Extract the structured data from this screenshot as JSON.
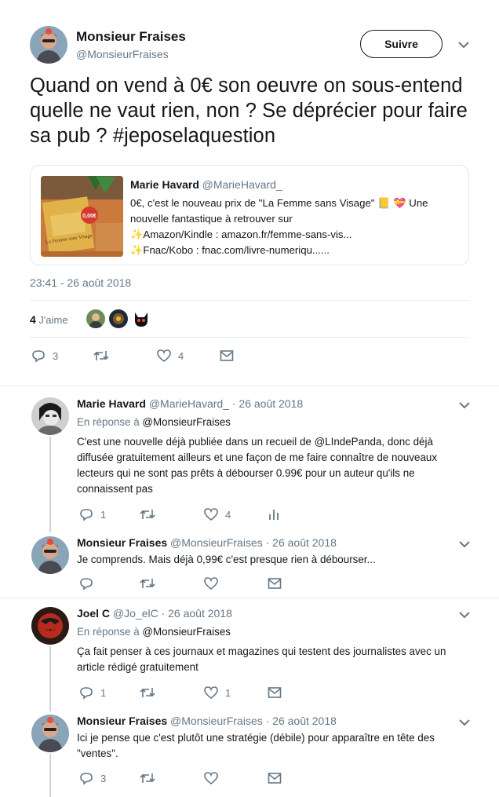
{
  "tweet": {
    "author_name": "Monsieur Fraises",
    "author_handle": "@MonsieurFraises",
    "follow_label": "Suivre",
    "text": "Quand on vend à 0€ son oeuvre on sous-entend quelle ne vaut rien, non ? Se déprécier pour faire sa pub ? #jeposelaquestion",
    "timestamp": "23:41 - 26 août 2018",
    "likes_count": "4",
    "likes_label": "J'aime",
    "replies": "3",
    "favorites": "4"
  },
  "quoted": {
    "author_name": "Marie Havard",
    "author_handle": "@MarieHavard_",
    "line1": "0€, c'est le nouveau prix de \"La Femme sans Visage\" 📒 💝 Une",
    "line2": "nouvelle fantastique à retrouver sur",
    "line3": "✨Amazon/Kindle : amazon.fr/femme-sans-vis...",
    "line4": "✨Fnac/Kobo : fnac.com/livre-numeriqu......",
    "image_price": "0,00€",
    "image_title": "La Femme sans Visage"
  },
  "replies": [
    {
      "author_name": "Marie Havard",
      "meta": "@MarieHavard_ · 26 août 2018",
      "reply_prefix": "En réponse à",
      "reply_to": "@MonsieurFraises",
      "lines": [
        "C'est une nouvelle déjà publiée dans un recueil de @LIndePanda, donc déjà",
        "diffusée gratuitement ailleurs et une façon de me faire connaître de nouveaux",
        "lecteurs qui ne sont pas prêts à débourser 0.99€ pour un auteur qu'ils ne",
        "connaissent pas"
      ],
      "reply_count": "1",
      "like_count": "4"
    },
    {
      "author_name": "Monsieur Fraises",
      "meta": "@MonsieurFraises · 26 août 2018",
      "lines": [
        "Je comprends. Mais déjà 0,99€ c'est presque rien à débourser..."
      ]
    },
    {
      "author_name": "Joel C",
      "meta": "@Jo_elC · 26 août 2018",
      "reply_prefix": "En réponse à",
      "reply_to": "@MonsieurFraises",
      "lines": [
        "Ça fait penser à ces journaux et magazines qui testent des journalistes avec un",
        "article rédigé gratuitement"
      ],
      "reply_count": "1",
      "like_count": "1"
    },
    {
      "author_name": "Monsieur Fraises",
      "meta": "@MonsieurFraises · 26 août 2018",
      "lines": [
        "Ici je pense que c'est plutôt une stratégie (débile) pour apparaître en tête des",
        "\"ventes\"."
      ],
      "reply_count": "3"
    }
  ],
  "colors": {
    "text": "#14171a",
    "secondary": "#657786",
    "divider": "#e6ecf0",
    "thread_line": "#ccd6dd"
  }
}
